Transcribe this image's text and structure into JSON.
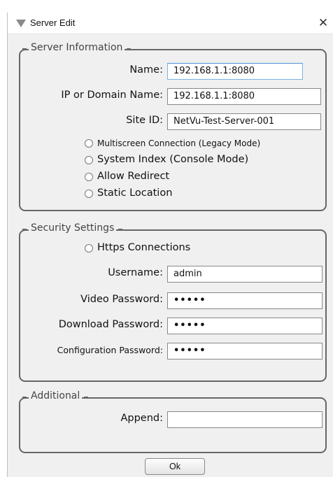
{
  "window": {
    "title": "Server Edit",
    "close_glyph": "✕"
  },
  "server_info": {
    "legend": "Server Information",
    "name_label": "Name:",
    "name_value": "192.168.1.1:8080",
    "ip_label": "IP or Domain Name:",
    "ip_value": "192.168.1.1:8080",
    "site_label": "Site ID:",
    "site_value": "NetVu-Test-Server-001",
    "options": [
      "Multiscreen Connection (Legacy Mode)",
      "System Index (Console Mode)",
      "Allow Redirect",
      "Static Location"
    ]
  },
  "security": {
    "legend": "Security Settings",
    "https_label": "Https Connections",
    "username_label": "Username:",
    "username_value": "admin",
    "video_pw_label": "Video Password:",
    "video_pw_value": "•••••",
    "download_pw_label": "Download Password:",
    "download_pw_value": "•••••",
    "config_pw_label": "Configuration Password:",
    "config_pw_value": "•••••"
  },
  "additional": {
    "legend": "Additional",
    "append_label": "Append:",
    "append_value": ""
  },
  "ok_label": "Ok"
}
